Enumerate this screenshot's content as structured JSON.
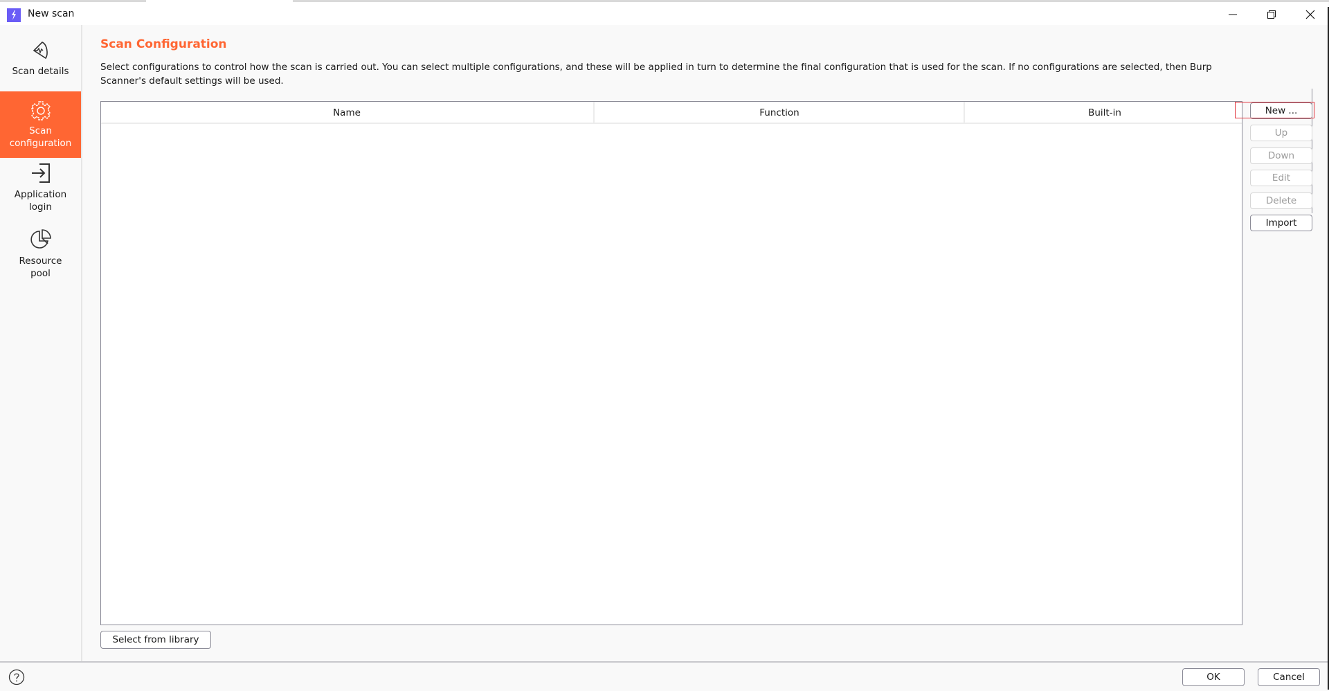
{
  "window": {
    "title": "New scan",
    "controls": {
      "minimize": "minimize",
      "restore": "restore",
      "close": "close"
    }
  },
  "sidebar": {
    "items": [
      {
        "label": "Scan details",
        "icon": "scan-details-icon",
        "active": false
      },
      {
        "label": "Scan configuration",
        "icon": "gear-icon",
        "active": true
      },
      {
        "label": "Application login",
        "icon": "login-icon",
        "active": false
      },
      {
        "label": "Resource pool",
        "icon": "pie-chart-icon",
        "active": false
      }
    ]
  },
  "main": {
    "title": "Scan Configuration",
    "description": "Select configurations to control how the scan is carried out. You can select multiple configurations, and these will be applied in turn to determine the final configuration that is used for the scan. If no configurations are selected, then Burp Scanner's default settings will be used.",
    "table": {
      "columns": [
        "Name",
        "Function",
        "Built-in"
      ],
      "rows": []
    },
    "buttons": {
      "new": "New ...",
      "up": "Up",
      "down": "Down",
      "edit": "Edit",
      "delete": "Delete",
      "import": "Import"
    },
    "select_from_library": "Select from library"
  },
  "footer": {
    "ok": "OK",
    "cancel": "Cancel"
  },
  "colors": {
    "accent": "#ff6633",
    "app_icon": "#6a5cf6",
    "highlight": "#e0303a"
  }
}
